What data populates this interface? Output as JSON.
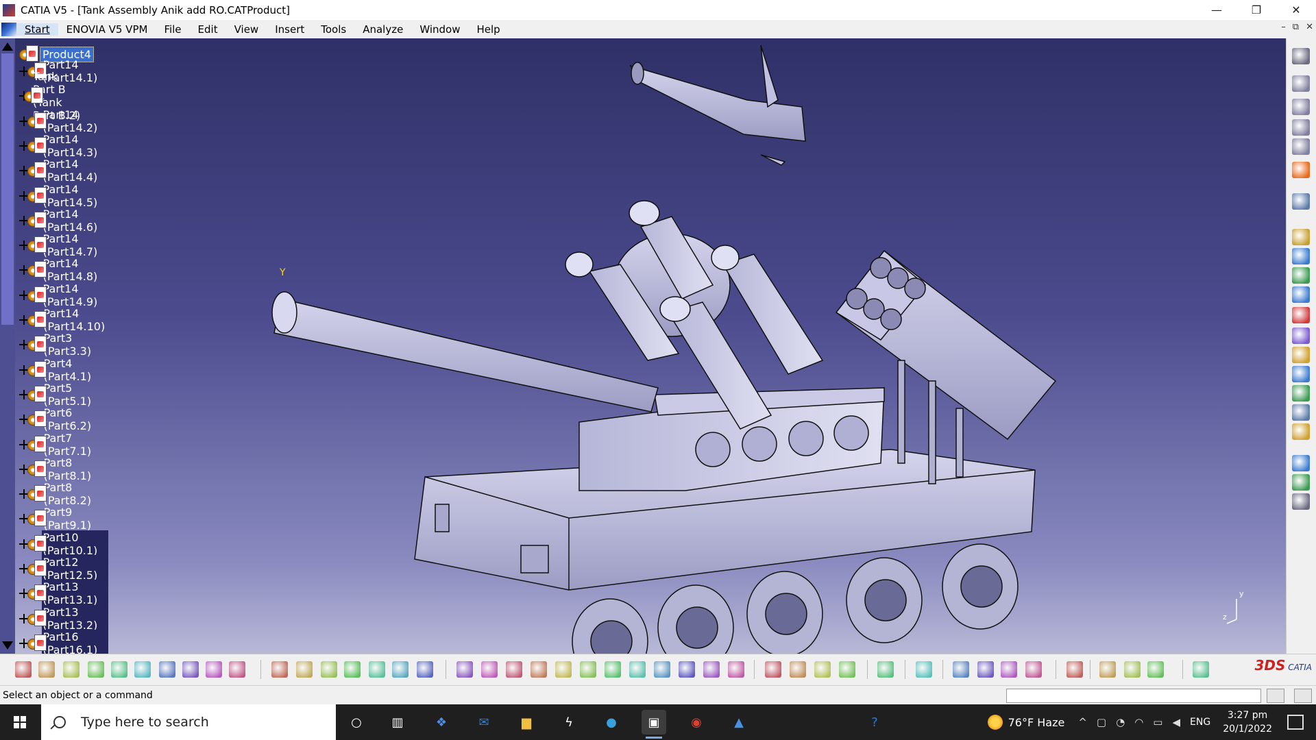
{
  "window": {
    "title": "CATIA V5 - [Tank Assembly Anik add  RO.CATProduct]",
    "minimize": "—",
    "restore": "❐",
    "close": "✕"
  },
  "menu": {
    "items": [
      "Start",
      "ENOVIA V5 VPM",
      "File",
      "Edit",
      "View",
      "Insert",
      "Tools",
      "Analyze",
      "Window",
      "Help"
    ],
    "doc_buttons": [
      "–",
      "⧉",
      "✕"
    ]
  },
  "tree": {
    "root": "Product4",
    "items": [
      {
        "label": "Part14 (Part14.1)",
        "selected": false
      },
      {
        "label": "Tank Part B (Tank Part B.2)",
        "selected": false
      },
      {
        "label": "Part14 (Part14.2)",
        "selected": false
      },
      {
        "label": "Part14 (Part14.3)",
        "selected": false
      },
      {
        "label": "Part14 (Part14.4)",
        "selected": false
      },
      {
        "label": "Part14 (Part14.5)",
        "selected": false
      },
      {
        "label": "Part14 (Part14.6)",
        "selected": false
      },
      {
        "label": "Part14 (Part14.7)",
        "selected": false
      },
      {
        "label": "Part14 (Part14.8)",
        "selected": false
      },
      {
        "label": "Part14 (Part14.9)",
        "selected": false
      },
      {
        "label": "Part14 (Part14.10)",
        "selected": false
      },
      {
        "label": "Part3 (Part3.3)",
        "selected": false
      },
      {
        "label": "Part4 (Part4.1)",
        "selected": false
      },
      {
        "label": "Part5 (Part5.1)",
        "selected": false
      },
      {
        "label": "Part6 (Part6.2)",
        "selected": false
      },
      {
        "label": "Part7 (Part7.1)",
        "selected": false
      },
      {
        "label": "Part8 (Part8.1)",
        "selected": false
      },
      {
        "label": "Part8 (Part8.2)",
        "selected": false
      },
      {
        "label": "Part9 (Part9.1)",
        "selected": false
      },
      {
        "label": "Part10 (Part10.1)",
        "selected": true
      },
      {
        "label": "Part12 (Part12.5)",
        "selected": true
      },
      {
        "label": "Part13 (Part13.1)",
        "selected": true
      },
      {
        "label": "Part13 (Part13.2)",
        "selected": true
      },
      {
        "label": "Part16 (Part16.1)",
        "selected": true
      }
    ]
  },
  "viewport": {
    "axis_mark": "Y",
    "triad": {
      "y": "y",
      "z": "z"
    }
  },
  "status": {
    "message": "Select an object or a command"
  },
  "catia_logo": {
    "mark": "3DS",
    "text": "CATIA"
  },
  "taskbar": {
    "search_placeholder": "Type here to search",
    "weather": "76°F  Haze",
    "language": "ENG",
    "time": "3:27 pm",
    "date": "20/1/2022",
    "tray_up": "^"
  },
  "colors": {
    "tree_selected": "#3a6fd0",
    "viewport_top": "#303068",
    "viewport_bottom": "#b8b8d6"
  }
}
